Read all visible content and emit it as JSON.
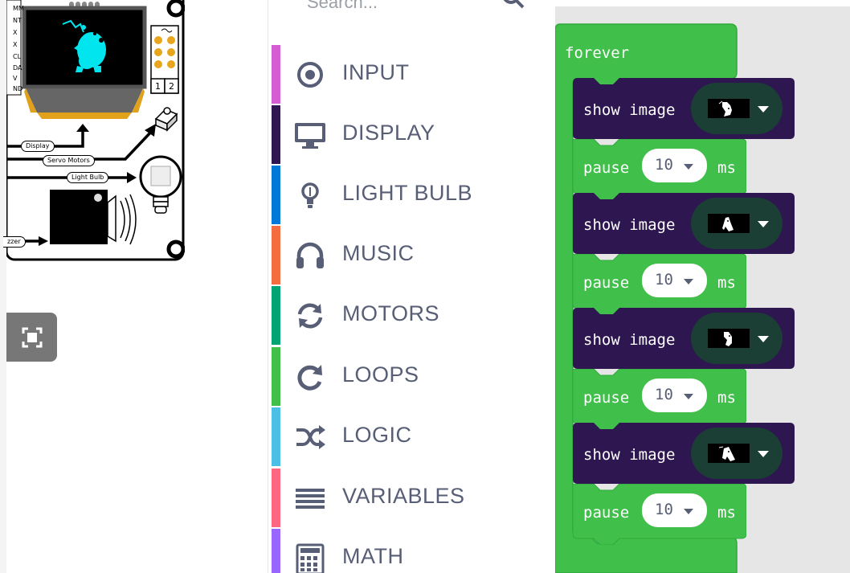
{
  "simulator": {
    "pin_labels": [
      "MM",
      "NT",
      "X",
      "X",
      "CL",
      "DA",
      "V",
      "ND"
    ],
    "header_labels": [
      "1",
      "2"
    ],
    "wire_labels": {
      "display": "Display",
      "servo": "Servo Motors",
      "light": "Light Bulb",
      "buzzer": "zzer"
    }
  },
  "toolbox": {
    "search_placeholder": "Search...",
    "categories": [
      {
        "label": "INPUT",
        "color": "#d65cd6",
        "icon": "target-icon"
      },
      {
        "label": "DISPLAY",
        "color": "#2e1650",
        "icon": "monitor-icon"
      },
      {
        "label": "LIGHT BULB",
        "color": "#0078d7",
        "icon": "lightbulb-icon"
      },
      {
        "label": "MUSIC",
        "color": "#f46d40",
        "icon": "headphones-icon"
      },
      {
        "label": "MOTORS",
        "color": "#00a473",
        "icon": "refresh-icon"
      },
      {
        "label": "LOOPS",
        "color": "#40bf4a",
        "icon": "redo-icon"
      },
      {
        "label": "LOGIC",
        "color": "#4cbfe6",
        "icon": "shuffle-icon"
      },
      {
        "label": "VARIABLES",
        "color": "#ff6680",
        "icon": "list-icon"
      },
      {
        "label": "MATH",
        "color": "#9966ff",
        "icon": "calculator-icon"
      }
    ]
  },
  "workspace": {
    "forever_label": "forever",
    "show_image_label": "show image",
    "pause_label": "pause",
    "pause_unit": "ms",
    "blocks": [
      {
        "type": "show_image",
        "frame": 1
      },
      {
        "type": "pause",
        "value": "10"
      },
      {
        "type": "show_image",
        "frame": 2
      },
      {
        "type": "pause",
        "value": "10"
      },
      {
        "type": "show_image",
        "frame": 3
      },
      {
        "type": "pause",
        "value": "10"
      },
      {
        "type": "show_image",
        "frame": 4
      },
      {
        "type": "pause",
        "value": "10"
      }
    ],
    "colors": {
      "loops": "#40bf4a",
      "display": "#2e1650",
      "image_field": "#1b3f35"
    }
  }
}
